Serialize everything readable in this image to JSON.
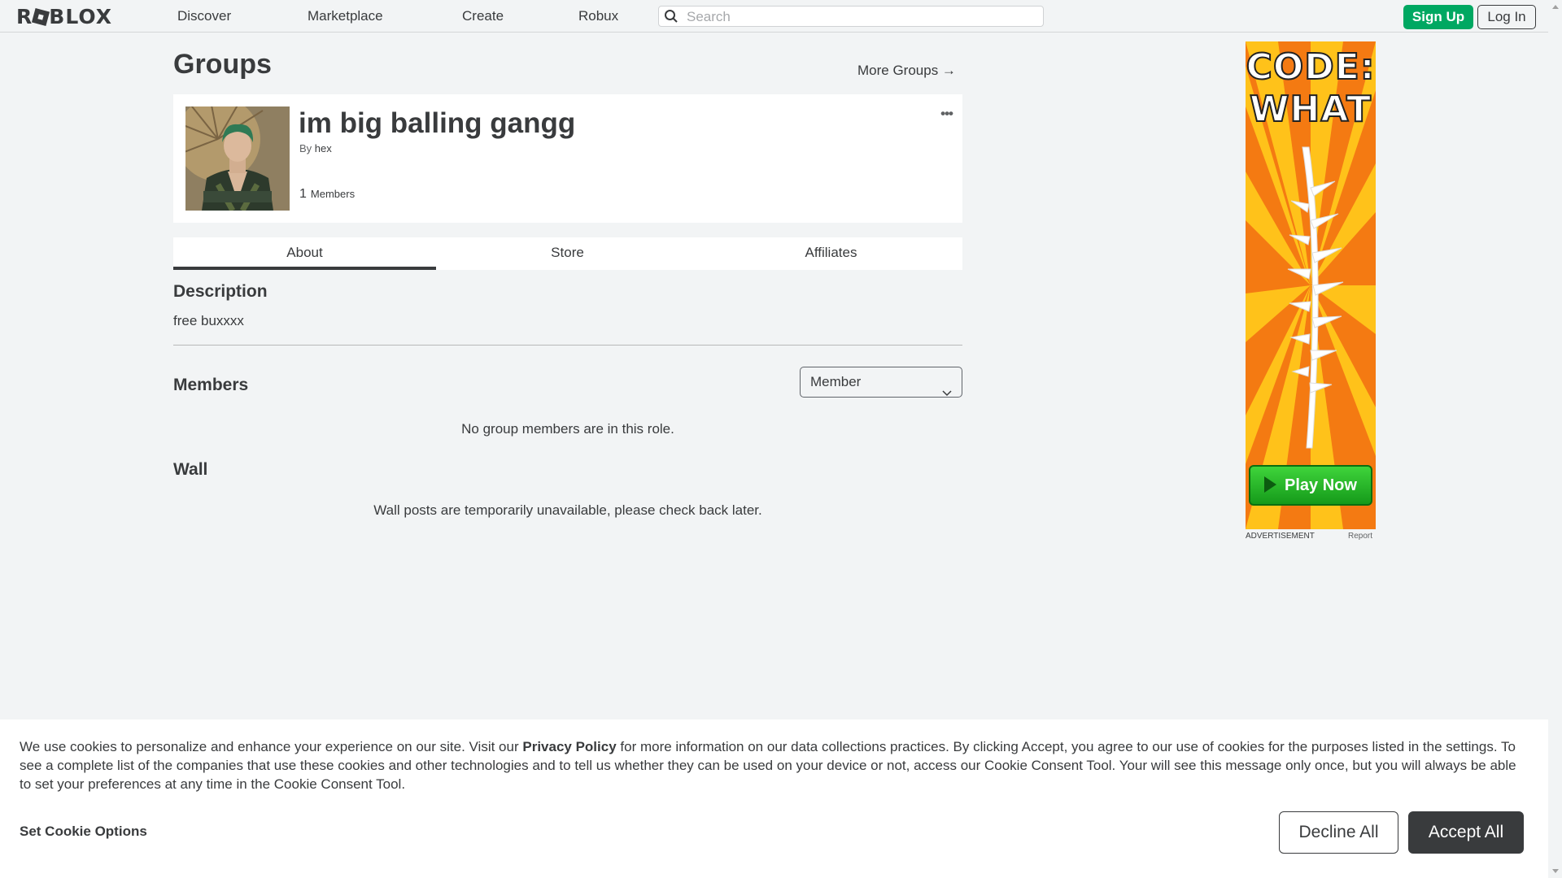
{
  "nav": {
    "logo": "ROBLOX",
    "links": [
      "Discover",
      "Marketplace",
      "Create",
      "Robux"
    ],
    "search_placeholder": "Search",
    "signup": "Sign Up",
    "login": "Log In"
  },
  "page": {
    "title": "Groups",
    "more_groups": "More Groups →"
  },
  "group": {
    "name": "im big balling gangg",
    "by_label": "By",
    "owner": "hex",
    "member_count": "1",
    "members_label": "Members",
    "menu_dots": "•••"
  },
  "tabs": [
    "About",
    "Store",
    "Affiliates"
  ],
  "about": {
    "description_heading": "Description",
    "description": "free buxxxx",
    "members_heading": "Members",
    "role_selected": "Member",
    "no_members": "No group members are in this role.",
    "wall_heading": "Wall",
    "wall_message": "Wall posts are temporarily unavailable, please check back later."
  },
  "ad": {
    "line1": "CODE:",
    "line2": "WHAT",
    "cta": "Play Now",
    "label": "ADVERTISEMENT",
    "report": "Report"
  },
  "cookie": {
    "text_before": "We use cookies to personalize and enhance your experience on our site. Visit our ",
    "privacy_link": "Privacy Policy",
    "text_after": " for more information on our data collections practices. By clicking Accept, you agree to our use of cookies for the purposes listed in the settings. To see a complete list of the companies that use these cookies and other technologies and to tell us whether they can be used on your device or not, access our Cookie Consent Tool. Your will see this message only once, but you will always be able to set your preferences at any time in the Cookie Consent Tool.",
    "set_options": "Set Cookie Options",
    "decline": "Decline All",
    "accept": "Accept All"
  },
  "colors": {
    "brand_green": "#00a862",
    "text_dark": "#393b3d",
    "page_bg": "#f2f4f5",
    "ad_orange": "#f47a12"
  }
}
